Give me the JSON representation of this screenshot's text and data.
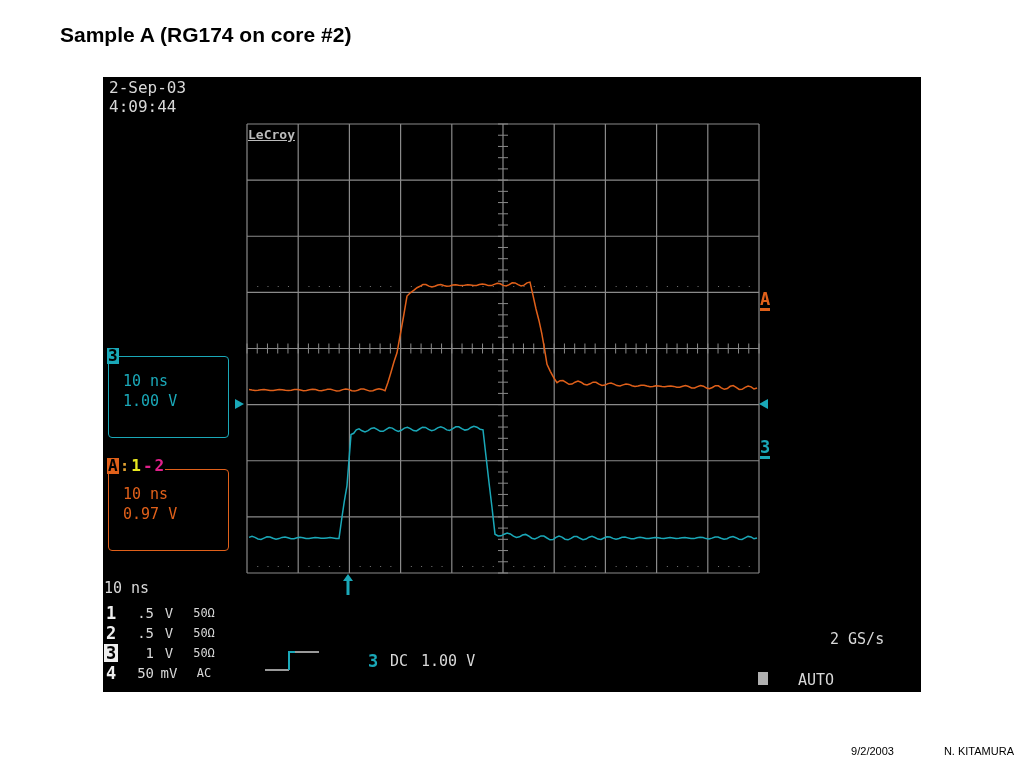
{
  "slide": {
    "title": "Sample A (RG174 on core #2)"
  },
  "scope": {
    "timestamp": [
      "2-Sep-03",
      "4:09:44"
    ],
    "logo": "LeCroy",
    "trace_markers": [
      {
        "label": "A",
        "color": "#e0601a"
      },
      {
        "label": "3",
        "color": "#1aa8b8"
      }
    ],
    "trace_boxes": [
      {
        "color": "#1aa8b8",
        "header": [
          {
            "text": "3",
            "color": "#1aa8b8",
            "boxed": true
          }
        ],
        "lines": [
          "10 ns",
          "1.00 V"
        ]
      },
      {
        "color": "#e0601a",
        "header": [
          {
            "text": "A",
            "color": "#e0601a",
            "boxed": true
          },
          {
            "text": ":",
            "color": "#e0a030",
            "boxed": false
          },
          {
            "text": "1",
            "color": "#e8e820",
            "boxed": false
          },
          {
            "text": "-",
            "color": "#e0208a",
            "boxed": false
          },
          {
            "text": "2",
            "color": "#e0208a",
            "boxed": false
          }
        ],
        "lines": [
          "10 ns",
          "0.97 V"
        ]
      }
    ],
    "timebase": "10 ns",
    "channels": [
      {
        "number": "1",
        "scale": ".5",
        "unit": "V",
        "coupling": "50Ω",
        "selected": false
      },
      {
        "number": "2",
        "scale": ".5",
        "unit": "V",
        "coupling": "50Ω",
        "selected": false
      },
      {
        "number": "3",
        "scale": "1",
        "unit": "V",
        "coupling": "50Ω",
        "selected": true
      },
      {
        "number": "4",
        "scale": "50",
        "unit": "mV",
        "coupling": "AC",
        "selected": false
      }
    ],
    "trigger": {
      "channel": "3",
      "color": "#1aa8b8",
      "coupling": "DC",
      "level": "1.00 V"
    },
    "sample_rate": "2 GS/s",
    "mode": "AUTO"
  },
  "footer": {
    "date": "9/2/2003",
    "author": "N. KITAMURA"
  }
}
